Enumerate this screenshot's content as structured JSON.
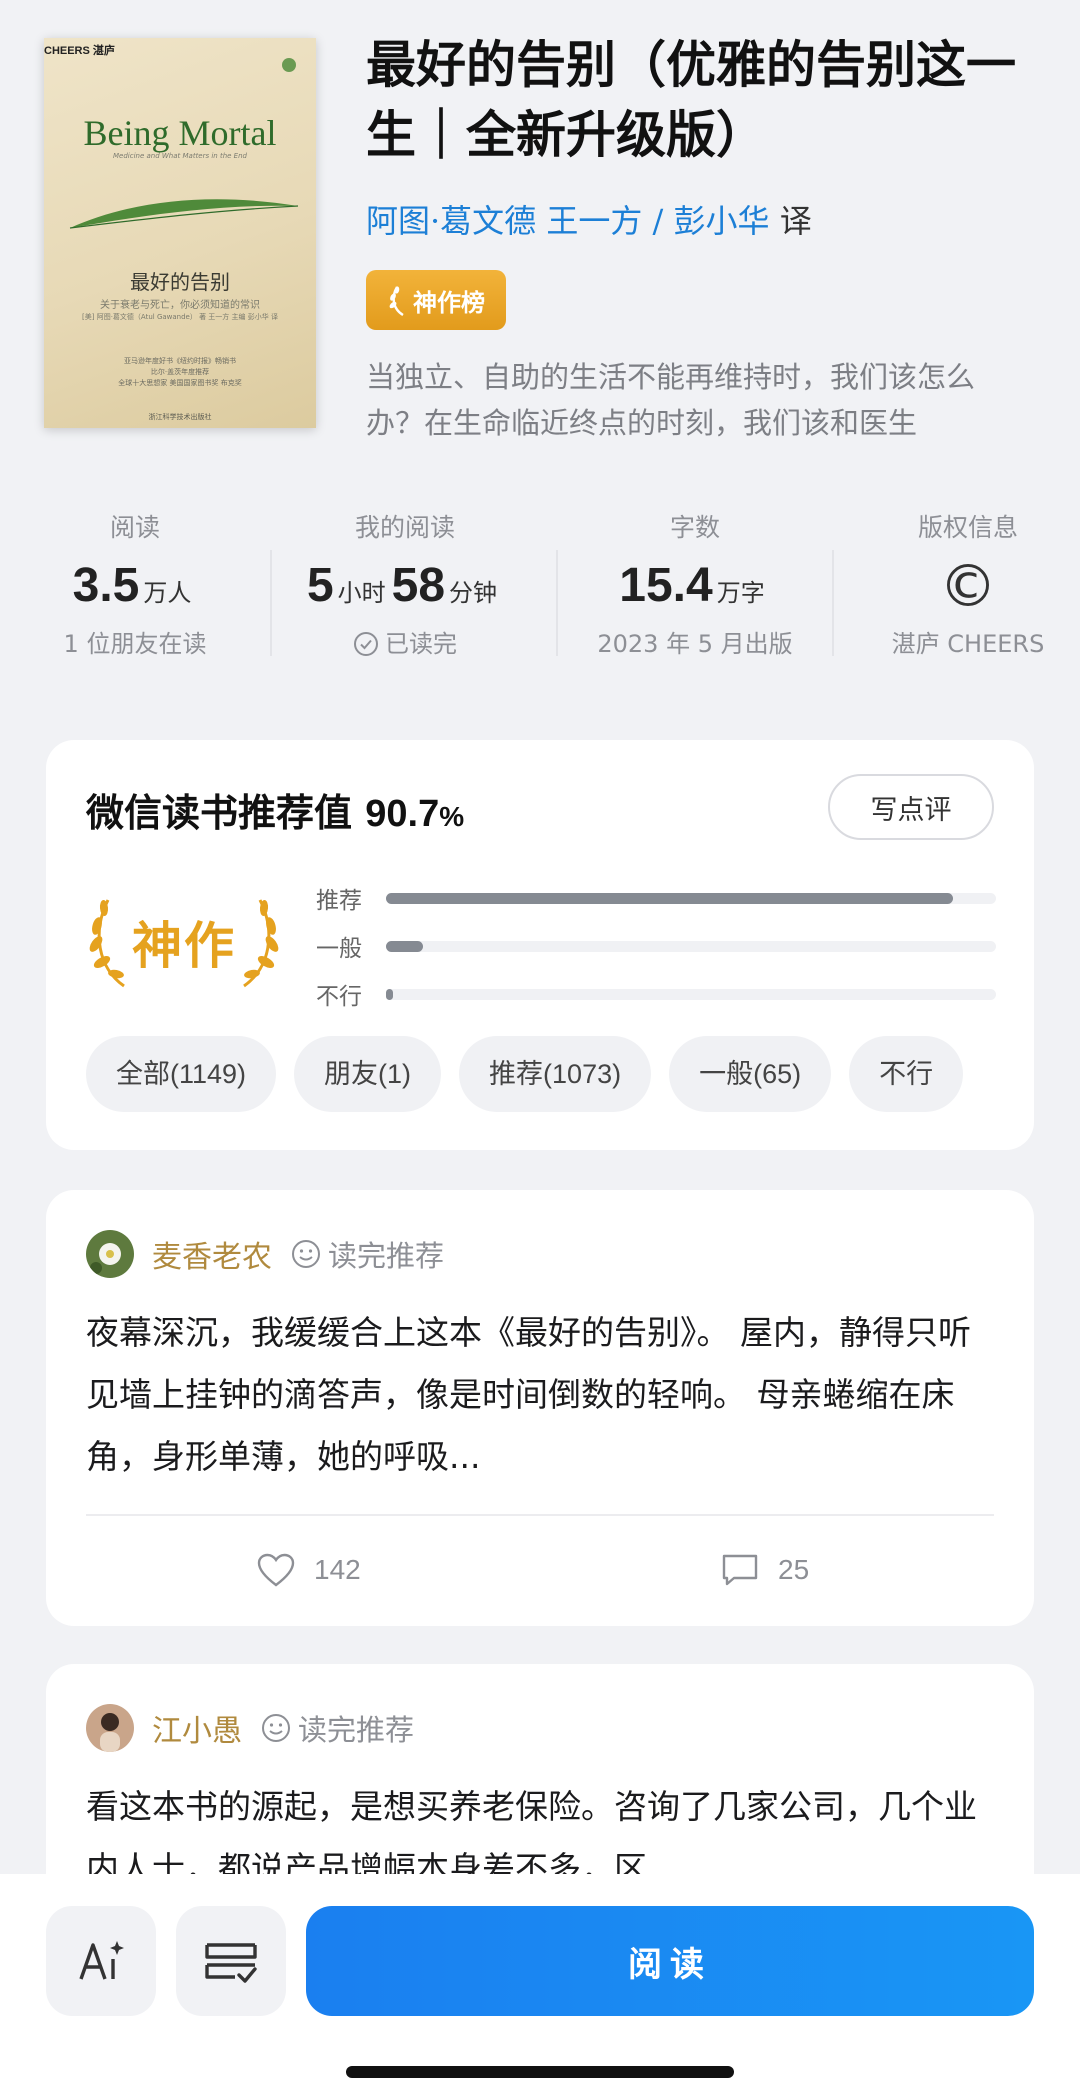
{
  "book": {
    "title": "最好的告别（优雅的告别这一生｜全新升级版）",
    "authors": [
      "阿图·葛文德",
      "王一方",
      "彭小华"
    ],
    "author_sep": " / ",
    "translator_role": "译",
    "badge": "神作榜",
    "intro": "当独立、自助的生活不能再维持时，我们该怎么办？在生命临近终点的时刻，我们该和医生"
  },
  "cover": {
    "publisher_mark": "CHEERS",
    "publisher_mark_cn": "湛庐",
    "en_title": "Being Mortal",
    "en_subtitle": "Medicine and What Matters in the End",
    "cn_title": "最好的告别",
    "cn_subtitle": "关于衰老与死亡，你必须知道的常识",
    "cn_authors": "[美] 阿图·葛文德（Atul Gawande） 著  王一方 主编  彭小华 译",
    "blurb": "亚马逊年度好书《纽约时报》畅销书\n比尔·盖茨年度推荐\n全球十大思想家 美国国家图书奖 布克奖",
    "press": "浙江科学技术出版社"
  },
  "stats": [
    {
      "label": "阅读",
      "value": "3.5",
      "unit": "万人",
      "sub": "1 位朋友在读"
    },
    {
      "label": "我的阅读",
      "value_h": "5",
      "unit_h": "小时",
      "value_m": "58",
      "unit_m": "分钟",
      "sub": "已读完"
    },
    {
      "label": "字数",
      "value": "15.4",
      "unit": "万字",
      "sub": "2023 年 5 月出版"
    },
    {
      "label": "版权信息",
      "symbol": "©",
      "sub": "湛庐 CHEERS"
    }
  ],
  "rating": {
    "title": "微信读书推荐值",
    "percent": "90.7",
    "percent_sign": "%",
    "write_button": "写点评",
    "level": "神作",
    "bars": [
      {
        "label": "推荐",
        "fraction": 0.93
      },
      {
        "label": "一般",
        "fraction": 0.06
      },
      {
        "label": "不行",
        "fraction": 0.01
      }
    ],
    "chips": [
      "全部(1149)",
      "朋友(1)",
      "推荐(1073)",
      "一般(65)",
      "不行"
    ]
  },
  "reviews": [
    {
      "name": "麦香老农",
      "tag": "读完推荐",
      "body": "夜幕深沉，我缓缓合上这本《最好的告别》。 屋内，静得只听见墙上挂钟的滴答声，像是时间倒数的轻响。 母亲蜷缩在床角，身形单薄，她的呼吸...",
      "likes": "142",
      "comments": "25"
    },
    {
      "name": "江小愚",
      "tag": "读完推荐",
      "body": "看这本书的源起，是想买养老保险。咨询了几家公司，几个业内人士，都说产品增幅本身差不多，区"
    }
  ],
  "bottom": {
    "read_button": "阅读"
  },
  "colors": {
    "accent_blue": "#1a7ff0",
    "badge_gold": "#e5a21f",
    "author_blue": "#1c7fd6",
    "reviewer_gold": "#b08a3e"
  }
}
